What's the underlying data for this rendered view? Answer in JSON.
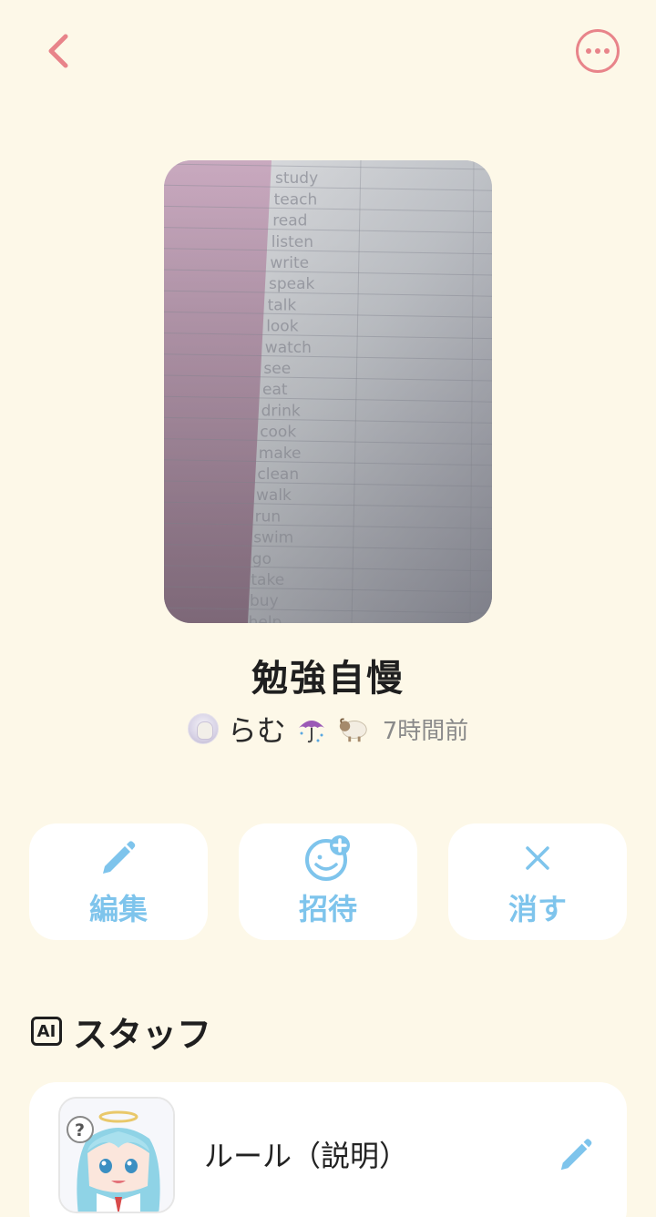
{
  "header": {
    "back_icon": "chevron-left-icon",
    "more_icon": "more-horizontal-icon",
    "accent_color": "#e8848a"
  },
  "post": {
    "title": "勉強自慢",
    "author_name": "らむ",
    "author_emojis": [
      "umbrella-icon",
      "sheep-icon"
    ],
    "time_ago": "7時間前",
    "image_subject": "vocabulary-worksheet-photo",
    "image_words": [
      "study",
      "teach",
      "read",
      "listen",
      "write",
      "speak",
      "talk",
      "look",
      "watch",
      "see",
      "eat",
      "drink",
      "cook",
      "make",
      "clean",
      "walk",
      "run",
      "swim",
      "go",
      "take",
      "buy",
      "help"
    ]
  },
  "actions": [
    {
      "label": "編集",
      "icon": "pencil-icon"
    },
    {
      "label": "招待",
      "icon": "add-friend-icon"
    },
    {
      "label": "消す",
      "icon": "close-icon"
    }
  ],
  "staff_section": {
    "badge": "AI",
    "title": "スタッフ"
  },
  "staff": [
    {
      "name": "ルール（説明）",
      "avatar": "anime-character-avatar",
      "edit_icon": "pencil-icon"
    }
  ],
  "colors": {
    "background": "#fdf8e8",
    "action_blue": "#7ec4ec",
    "card": "#ffffff"
  }
}
